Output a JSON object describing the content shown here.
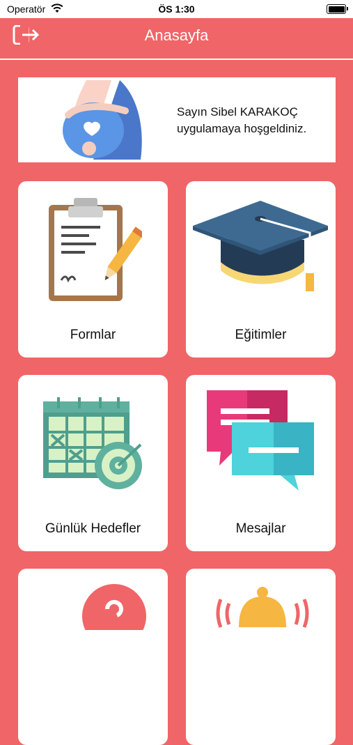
{
  "status_bar": {
    "carrier": "Operatör",
    "time": "ÖS 1:30"
  },
  "nav": {
    "title": "Anasayfa",
    "logout_icon": "logout-icon"
  },
  "welcome": {
    "line1": "Sayın Sibel KARAKOÇ",
    "line2": "uygulamaya hoşgeldiniz."
  },
  "menu": [
    {
      "label": "Formlar",
      "icon": "clipboard-icon"
    },
    {
      "label": "Eğitimler",
      "icon": "graduation-cap-icon"
    },
    {
      "label": "Günlük Hedefler",
      "icon": "calendar-target-icon"
    },
    {
      "label": "Mesajlar",
      "icon": "chat-bubbles-icon"
    },
    {
      "label": "",
      "icon": "question-icon"
    },
    {
      "label": "",
      "icon": "alarm-bell-icon"
    }
  ],
  "colors": {
    "accent": "#F06567",
    "card": "#ffffff"
  }
}
